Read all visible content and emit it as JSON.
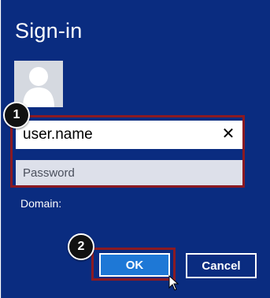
{
  "dialog": {
    "title": "Sign-in",
    "username": {
      "value": "user.name",
      "clear_glyph": "✕"
    },
    "password": {
      "placeholder": "Password"
    },
    "domain_label": "Domain:",
    "buttons": {
      "ok": "OK",
      "cancel": "Cancel"
    }
  },
  "annotations": {
    "step1": "1",
    "step2": "2"
  },
  "colors": {
    "background": "#0a2c80",
    "ok_button": "#1e78d6",
    "highlight_border": "#8b1a22",
    "avatar_bg": "#d5d9e0"
  },
  "icons": [
    "user-avatar-icon",
    "clear-icon",
    "mouse-cursor-icon"
  ]
}
